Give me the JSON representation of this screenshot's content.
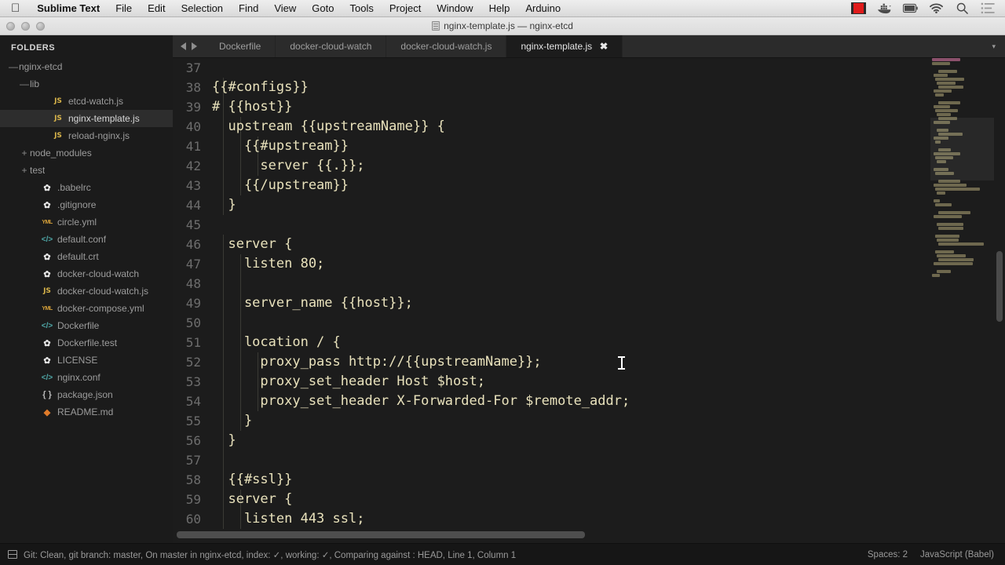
{
  "menubar": {
    "apple_glyph": "",
    "items": [
      {
        "label": "Sublime Text",
        "bold": true
      },
      {
        "label": "File",
        "bold": false
      },
      {
        "label": "Edit",
        "bold": false
      },
      {
        "label": "Selection",
        "bold": false
      },
      {
        "label": "Find",
        "bold": false
      },
      {
        "label": "View",
        "bold": false
      },
      {
        "label": "Goto",
        "bold": false
      },
      {
        "label": "Tools",
        "bold": false
      },
      {
        "label": "Project",
        "bold": false
      },
      {
        "label": "Window",
        "bold": false
      },
      {
        "label": "Help",
        "bold": false
      },
      {
        "label": "Arduino",
        "bold": false
      }
    ],
    "tray_icons": [
      "screen-recorder-icon",
      "docker-whale-icon",
      "battery-icon",
      "wifi-icon",
      "search-icon",
      "notification-center-icon"
    ]
  },
  "titlebar": {
    "title": "nginx-template.js — nginx-etcd",
    "document_icon": "document-icon",
    "traffic_lights": [
      "close",
      "minimize",
      "zoom"
    ]
  },
  "sidebar": {
    "header": "FOLDERS",
    "items": [
      {
        "label": "nginx-etcd",
        "indent": 0,
        "twisty": "—",
        "icon": "",
        "selected": false
      },
      {
        "label": "lib",
        "indent": 1,
        "twisty": "—",
        "icon": "",
        "selected": false
      },
      {
        "label": "etcd-watch.js",
        "indent": 3,
        "twisty": "",
        "icon": "js",
        "icon_text": "JS",
        "selected": false
      },
      {
        "label": "nginx-template.js",
        "indent": 3,
        "twisty": "",
        "icon": "js",
        "icon_text": "JS",
        "selected": true
      },
      {
        "label": "reload-nginx.js",
        "indent": 3,
        "twisty": "",
        "icon": "js",
        "icon_text": "JS",
        "selected": false
      },
      {
        "label": "node_modules",
        "indent": 1,
        "twisty": "+",
        "icon": "",
        "selected": false
      },
      {
        "label": "test",
        "indent": 1,
        "twisty": "+",
        "icon": "",
        "selected": false
      },
      {
        "label": ".babelrc",
        "indent": 2,
        "twisty": "",
        "icon": "gear",
        "icon_text": "✿",
        "selected": false
      },
      {
        "label": ".gitignore",
        "indent": 2,
        "twisty": "",
        "icon": "gear",
        "icon_text": "✿",
        "selected": false
      },
      {
        "label": "circle.yml",
        "indent": 2,
        "twisty": "",
        "icon": "yml",
        "icon_text": "YML",
        "selected": false
      },
      {
        "label": "default.conf",
        "indent": 2,
        "twisty": "",
        "icon": "code",
        "icon_text": "</>",
        "selected": false
      },
      {
        "label": "default.crt",
        "indent": 2,
        "twisty": "",
        "icon": "gear",
        "icon_text": "✿",
        "selected": false
      },
      {
        "label": "docker-cloud-watch",
        "indent": 2,
        "twisty": "",
        "icon": "gear",
        "icon_text": "✿",
        "selected": false
      },
      {
        "label": "docker-cloud-watch.js",
        "indent": 2,
        "twisty": "",
        "icon": "js",
        "icon_text": "JS",
        "selected": false
      },
      {
        "label": "docker-compose.yml",
        "indent": 2,
        "twisty": "",
        "icon": "yml",
        "icon_text": "YML",
        "selected": false
      },
      {
        "label": "Dockerfile",
        "indent": 2,
        "twisty": "",
        "icon": "code",
        "icon_text": "</>",
        "selected": false
      },
      {
        "label": "Dockerfile.test",
        "indent": 2,
        "twisty": "",
        "icon": "gear",
        "icon_text": "✿",
        "selected": false
      },
      {
        "label": "LICENSE",
        "indent": 2,
        "twisty": "",
        "icon": "gear",
        "icon_text": "✿",
        "selected": false
      },
      {
        "label": "nginx.conf",
        "indent": 2,
        "twisty": "",
        "icon": "code",
        "icon_text": "</>",
        "selected": false
      },
      {
        "label": "package.json",
        "indent": 2,
        "twisty": "",
        "icon": "json",
        "icon_text": "{ }",
        "selected": false
      },
      {
        "label": "README.md",
        "indent": 2,
        "twisty": "",
        "icon": "md",
        "icon_text": "◆",
        "selected": false
      }
    ]
  },
  "tabs": {
    "nav_prev": "prev-tab-arrow",
    "nav_next": "next-tab-arrow",
    "items": [
      {
        "label": "Dockerfile",
        "active": false,
        "closable": false
      },
      {
        "label": "docker-cloud-watch",
        "active": false,
        "closable": false
      },
      {
        "label": "docker-cloud-watch.js",
        "active": false,
        "closable": false
      },
      {
        "label": "nginx-template.js",
        "active": true,
        "closable": true,
        "close_glyph": "✖"
      }
    ],
    "overflow_glyph": "▾"
  },
  "editor": {
    "first_line": 37,
    "text_color": "#e9e2bc",
    "background": "#1c1c1c",
    "lines": [
      {
        "n": 37,
        "text": ""
      },
      {
        "n": 38,
        "text": "{{#configs}}"
      },
      {
        "n": 39,
        "text": "# {{host}}"
      },
      {
        "n": 40,
        "text": "  upstream {{upstreamName}} {"
      },
      {
        "n": 41,
        "text": "    {{#upstream}}"
      },
      {
        "n": 42,
        "text": "      server {{.}};"
      },
      {
        "n": 43,
        "text": "    {{/upstream}}"
      },
      {
        "n": 44,
        "text": "  }"
      },
      {
        "n": 45,
        "text": ""
      },
      {
        "n": 46,
        "text": "  server {"
      },
      {
        "n": 47,
        "text": "    listen 80;"
      },
      {
        "n": 48,
        "text": ""
      },
      {
        "n": 49,
        "text": "    server_name {{host}};"
      },
      {
        "n": 50,
        "text": ""
      },
      {
        "n": 51,
        "text": "    location / {"
      },
      {
        "n": 52,
        "text": "      proxy_pass http://{{upstreamName}};"
      },
      {
        "n": 53,
        "text": "      proxy_set_header Host $host;"
      },
      {
        "n": 54,
        "text": "      proxy_set_header X-Forwarded-For $remote_addr;"
      },
      {
        "n": 55,
        "text": "    }"
      },
      {
        "n": 56,
        "text": "  }"
      },
      {
        "n": 57,
        "text": ""
      },
      {
        "n": 58,
        "text": "  {{#ssl}}"
      },
      {
        "n": 59,
        "text": "  server {"
      },
      {
        "n": 60,
        "text": "    listen 443 ssl;"
      }
    ]
  },
  "status": {
    "git_icon": "git-status-icon",
    "left": "Git: Clean, git branch: master, On master in nginx-etcd, index: ✓, working: ✓, Comparing against : HEAD, Line 1, Column 1",
    "indentation": "Spaces: 2",
    "syntax": "JavaScript (Babel)"
  }
}
